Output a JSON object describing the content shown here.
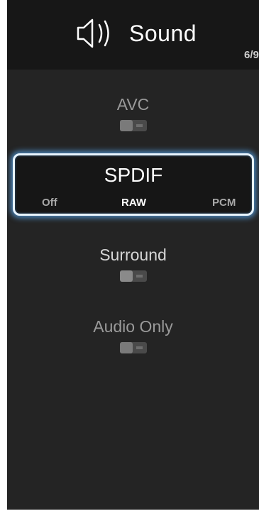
{
  "header": {
    "title": "Sound",
    "icon": "speaker-icon",
    "page_count": "6/9"
  },
  "items": [
    {
      "label": "AVC",
      "toggle_state": "off"
    },
    {
      "label": "SPDIF",
      "selected": true,
      "options": [
        "Off",
        "RAW",
        "PCM"
      ],
      "current_option": "RAW"
    },
    {
      "label": "Surround",
      "toggle_state": "off"
    },
    {
      "label": "Audio Only",
      "toggle_state": "off"
    }
  ],
  "colors": {
    "background": "#242424",
    "header": "#171717",
    "focus_glow": "#5aaaf0"
  }
}
